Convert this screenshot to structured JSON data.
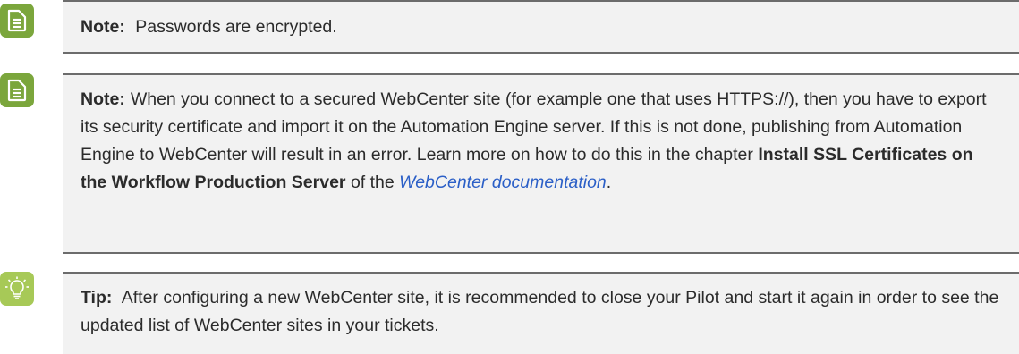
{
  "note1": {
    "label": "Note:",
    "text": "Passwords are encrypted.",
    "icon": "note-icon"
  },
  "note2": {
    "label": "Note:",
    "text_1": "When you connect to a secured WebCenter site (for example one that uses HTTPS://), then you have to export its security certificate and import it on the Automation Engine server. If this is not done, publishing from Automation Engine to WebCenter will result in an error. Learn more on how to do this in the chapter ",
    "chapter": "Install SSL Certificates on the Workflow Production Server",
    "text_2": " of the ",
    "link": "WebCenter documentation",
    "text_3": ".",
    "icon": "note-icon"
  },
  "tip": {
    "label": "Tip:",
    "text": "After configuring a new WebCenter site, it is recommended to close your Pilot and start it again in order to see the updated list of WebCenter sites in your tickets.",
    "icon": "lightbulb-icon"
  },
  "colors": {
    "note_icon_bg": "#7ba63c",
    "tip_icon_bg": "#a7c957",
    "box_bg": "#f2f2f2",
    "border": "#6c6c6c",
    "link": "#2b5fc7"
  }
}
